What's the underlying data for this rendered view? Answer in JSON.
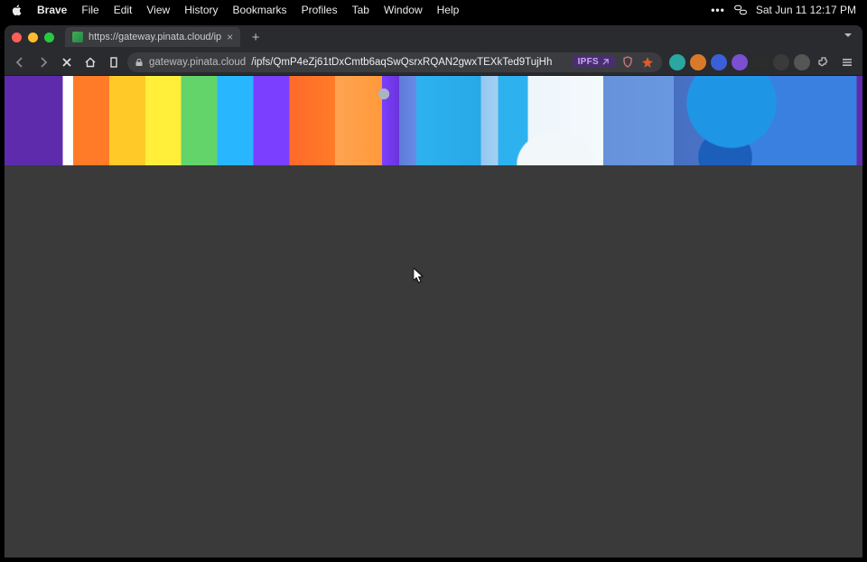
{
  "menubar": {
    "app_name": "Brave",
    "items": [
      "File",
      "Edit",
      "View",
      "History",
      "Bookmarks",
      "Profiles",
      "Tab",
      "Window",
      "Help"
    ],
    "datetime": "Sat Jun 11  12:17 PM"
  },
  "tab": {
    "title": "https://gateway.pinata.cloud/ip",
    "close_glyph": "×"
  },
  "toolbar": {
    "newtab_glyph": "+",
    "url_domain": "gateway.pinata.cloud",
    "url_path": "/ipfs/QmP4eZj61tDxCmtb6aqSwQsrxRQAN2gwxTEXkTed9TujHh",
    "ipfs_label": "IPFS"
  },
  "extensions": [
    {
      "name": "ext-teal",
      "bg": "#2aa7a0"
    },
    {
      "name": "ext-orange",
      "bg": "#d97a2a"
    },
    {
      "name": "ext-blue",
      "bg": "#3a5fd8"
    },
    {
      "name": "ext-purple",
      "bg": "#7a4fd0"
    },
    {
      "name": "ext-dark1",
      "bg": "#2c2c2c"
    },
    {
      "name": "ext-dark2",
      "bg": "#3a3a3a"
    },
    {
      "name": "ext-gray",
      "bg": "#555"
    }
  ]
}
